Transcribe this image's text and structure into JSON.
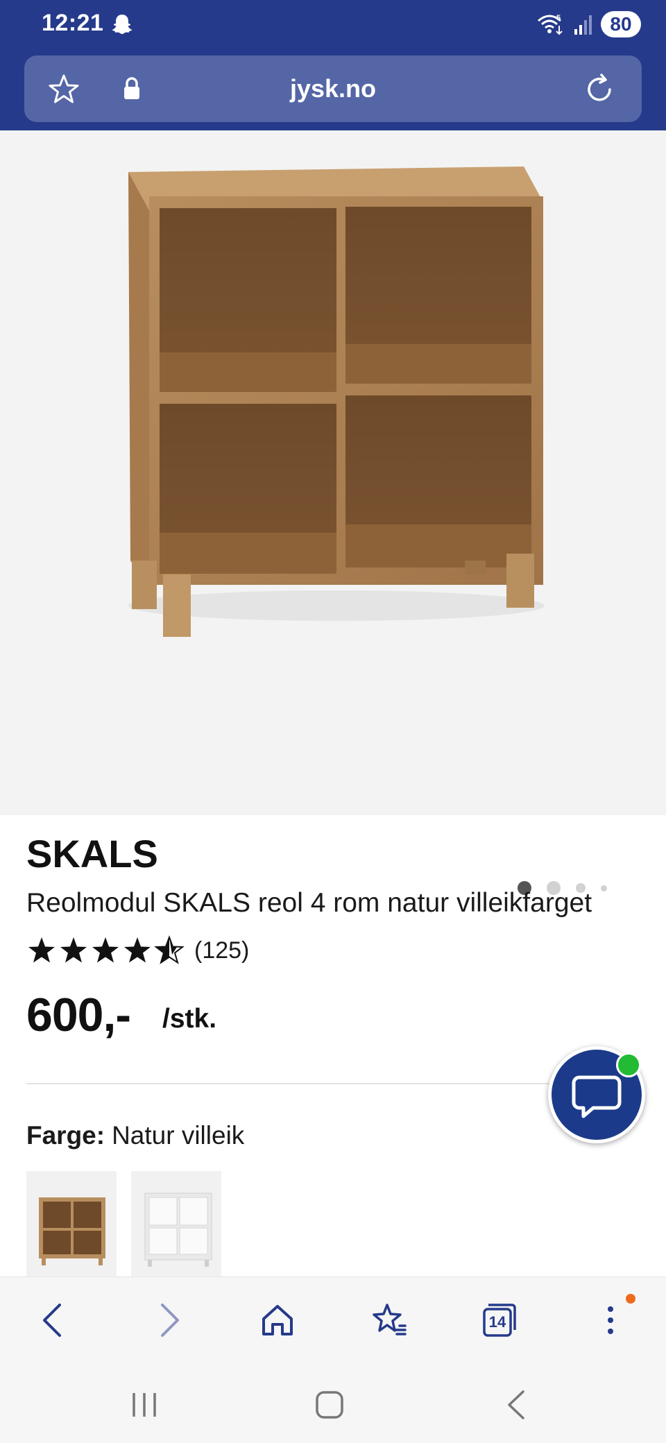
{
  "status_bar": {
    "time": "12:21",
    "battery": "80"
  },
  "browser": {
    "url": "jysk.no",
    "tab_count": "14"
  },
  "product": {
    "brand": "SKALS",
    "title": "Reolmodul SKALS reol 4 rom natur villeikfarget",
    "rating_stars": 4.5,
    "rating_count": "(125)",
    "price": "600,-",
    "unit": "/stk.",
    "color_label": "Farge:",
    "color_value": "Natur villeik",
    "image_dots": 4,
    "active_image": 1
  },
  "colors": {
    "brand_blue": "#253a8a",
    "url_bar": "#5466a6",
    "chat_blue": "#1b3a8a",
    "online_green": "#22bb33",
    "notify_orange": "#f06a1d"
  }
}
